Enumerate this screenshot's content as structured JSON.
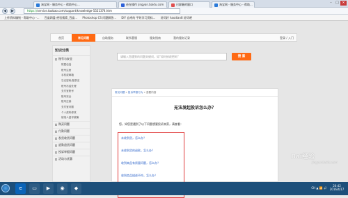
{
  "browser": {
    "tabs": [
      {
        "label": "淘宝网 - 服务中心 - 帮助中心..."
      },
      {
        "label": "还在操作 jingyan.baidu.com"
      },
      {
        "label": "已屏蔽的窗口"
      },
      {
        "label": "淘宝网 - 服务中心 - 帮助..."
      }
    ],
    "url_secure": "https://",
    "url_rest": "service.taobao.com/support/knowledge-5521374.htm",
    "nav_back": "◀",
    "nav_forward": "▶",
    "bookmarks": [
      "上传资料赚钱 - 帮助中心 -...",
      "百度网盘-经验搜索_百度...",
      "Photoshop CS 问题解答...",
      "DIY 自考的 平时学习资料...",
      "好词好 haodian8 好词吧"
    ]
  },
  "site": {
    "nav": [
      "首页",
      "常见问题",
      "自助服务",
      "联系客服",
      "服务指南",
      "我的服务记录"
    ],
    "login": "登录 / 入门",
    "search_placeholder": "请输入您遇到的问题关键词，如\"如何修改密码\"",
    "search_button": "搜 索"
  },
  "sidebar": {
    "title": "知识分类",
    "section": "账号与安全",
    "subitems": [
      "附属包括",
      "账号注册",
      "手机或邮箱",
      "忘记密码/登录名",
      "账号冻结处理",
      "支付宝账号",
      "账号安全",
      "账号注销",
      "支付宝问题",
      "个人资料修改",
      "被他人盗号被骗"
    ],
    "categories": [
      "购买问题",
      "付款问题",
      "发货收货问题",
      "退款退货问题",
      "投诉举报问题",
      "活动与优惠"
    ]
  },
  "content": {
    "breadcrumb_home": "常见问题",
    "breadcrumb_parent": "投诉举报行为",
    "breadcrumb_current": "查看内容",
    "breadcrumb_sep": "»",
    "title": "无法发起投诉怎么办？",
    "intro": "您，如您是遇到了以下问题想要投诉卖家，请查看：",
    "links": [
      "未收到货，怎么办？",
      "未收到货的退款，怎么办？",
      "收到商品有质量问题，怎么办？",
      "收到商品描述不符，怎么办？",
      "收到商品发错货，怎么办？"
    ]
  },
  "watermark": {
    "logo": "Bai经验",
    "url": "jingyan.baidu.com"
  },
  "taskbar": {
    "clock_time": "20:42",
    "clock_date": "2016/4/17",
    "tray": "CH ▲ 📶 🔊"
  },
  "colors": {
    "accent": "#ff6a14",
    "link": "#2a62c9",
    "highlight_border": "#e03a3a"
  }
}
